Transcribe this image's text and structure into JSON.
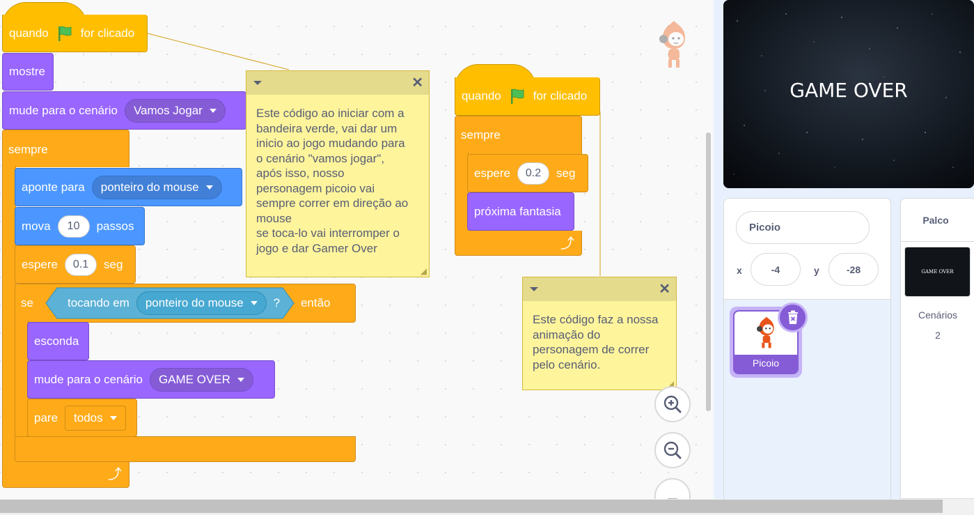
{
  "script1": {
    "hat": {
      "when": "quando",
      "clicked": "for clicado"
    },
    "show": "mostre",
    "switch_backdrop": {
      "label": "mude para o cenário",
      "value": "Vamos Jogar"
    },
    "forever": "sempre",
    "point_towards": {
      "label": "aponte para",
      "value": "ponteiro do mouse"
    },
    "move": {
      "label": "mova",
      "value": "10",
      "unit": "passos"
    },
    "wait": {
      "label": "espere",
      "value": "0.1",
      "unit": "seg"
    },
    "if_block": {
      "if": "se",
      "then": "então",
      "touching": "tocando em",
      "touching_value": "ponteiro do mouse",
      "q": "?"
    },
    "hide": "esconda",
    "switch_backdrop2": {
      "label": "mude para o cenário",
      "value": "GAME OVER"
    },
    "stop": {
      "label": "pare",
      "value": "todos"
    }
  },
  "script2": {
    "hat": {
      "when": "quando",
      "clicked": "for clicado"
    },
    "forever": "sempre",
    "wait": {
      "label": "espere",
      "value": "0.2",
      "unit": "seg"
    },
    "next_costume": "próxima fantasia"
  },
  "note1": "Este código ao iniciar com a\nbandeira verde, vai dar um\ninicio ao jogo mudando para\no cenário \"vamos jogar\",\napós isso, nosso\npersonagem picoio vai\nsempre correr em direção ao\nmouse\nse toca-lo vai interromper o\njogo e dar Gamer Over",
  "note2": "Este código faz a nossa\nanimação do\npersonagem de correr\npelo cenário.",
  "stage": {
    "text": "GAME OVER"
  },
  "sprite_info": {
    "name": "Picoio",
    "x_label": "x",
    "x_value": "-4",
    "y_label": "y",
    "y_value": "-28"
  },
  "sprite_tile": {
    "name": "Picoio"
  },
  "stage_panel": {
    "title": "Palco",
    "thumb_text": "GAME OVER",
    "backdrops_label": "Cenários",
    "backdrops_count": "2"
  },
  "colors": {
    "events": "#ffbf00",
    "looks": "#9966ff",
    "motion": "#4c97ff",
    "control": "#ffab19",
    "sensing": "#5cb1d6",
    "note": "#fef49c"
  }
}
